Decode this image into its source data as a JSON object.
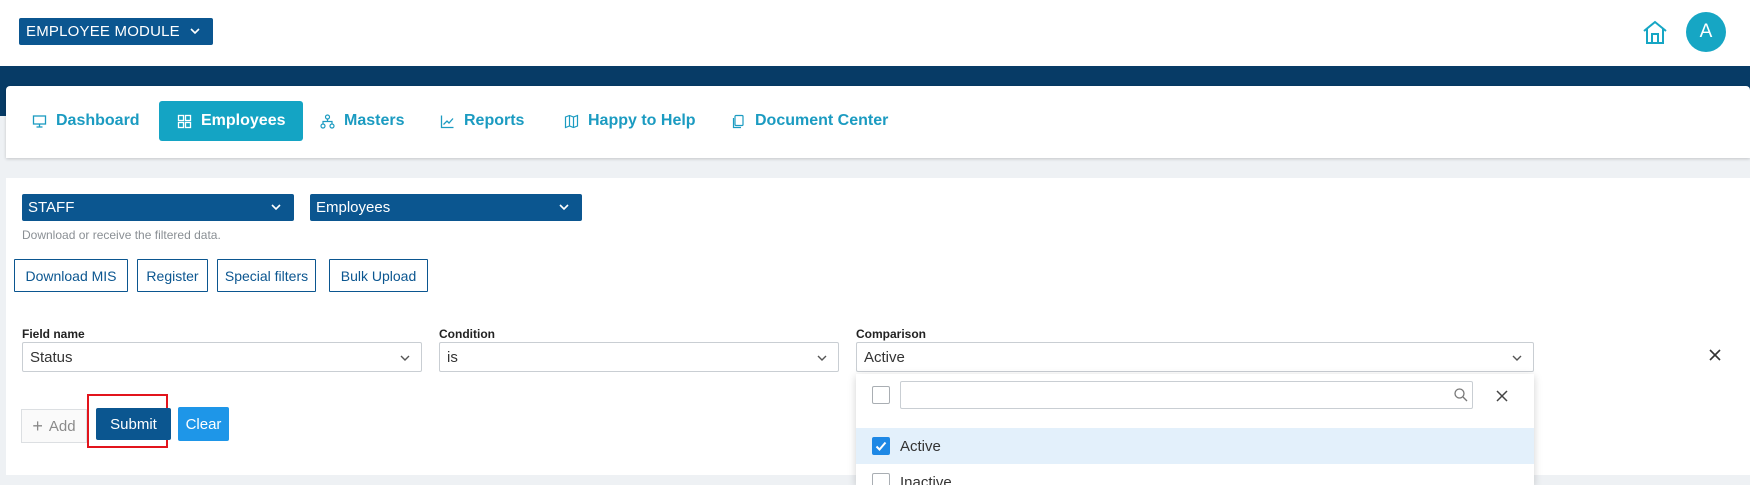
{
  "header": {
    "module_selector": "EMPLOYEE MODULE",
    "avatar_initial": "A"
  },
  "nav": {
    "tabs": [
      {
        "label": "Dashboard",
        "icon": "monitor-icon"
      },
      {
        "label": "Employees",
        "icon": "grid-icon",
        "active": true
      },
      {
        "label": "Masters",
        "icon": "hierarchy-icon"
      },
      {
        "label": "Reports",
        "icon": "trend-chart-icon"
      },
      {
        "label": "Happy to Help",
        "icon": "map-icon"
      },
      {
        "label": "Document Center",
        "icon": "documents-icon"
      }
    ]
  },
  "filters": {
    "category": "STAFF",
    "dataset": "Employees",
    "hint": "Download or receive the filtered data."
  },
  "actions": {
    "download_mis": "Download MIS",
    "register": "Register",
    "special_filters": "Special filters",
    "bulk_upload": "Bulk Upload"
  },
  "criteria": {
    "field_label": "Field name",
    "field_value": "Status",
    "condition_label": "Condition",
    "condition_value": "is",
    "comparison_label": "Comparison",
    "comparison_value": "Active"
  },
  "buttons": {
    "add": "Add",
    "submit": "Submit",
    "clear": "Clear"
  },
  "dropdown": {
    "search_value": "",
    "options": [
      {
        "label": "Active",
        "checked": true
      },
      {
        "label": "Inactive",
        "checked": false
      }
    ]
  },
  "colors": {
    "brand_dark_blue": "#0b5690",
    "nav_bar_blue": "#073b66",
    "accent_cyan": "#14a4c4",
    "clear_button_blue": "#1e96e8",
    "highlight_red": "#e2141c"
  }
}
